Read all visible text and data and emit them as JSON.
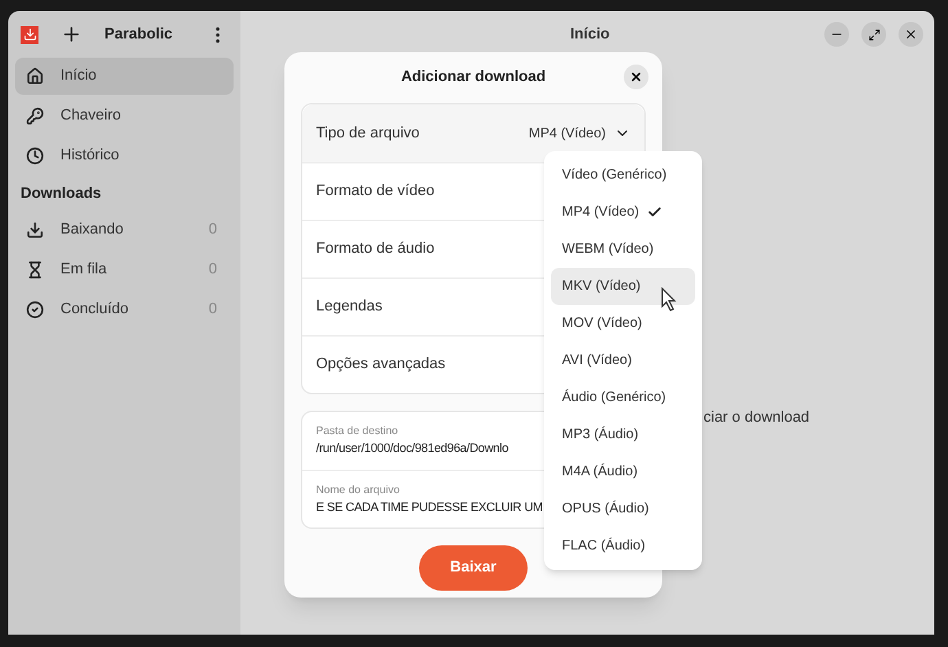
{
  "header": {
    "title": "Parabolic"
  },
  "sidebar": {
    "items": [
      {
        "label": "Início",
        "selected": true
      },
      {
        "label": "Chaveiro",
        "selected": false
      },
      {
        "label": "Histórico",
        "selected": false
      }
    ],
    "section": "Downloads",
    "downloads": [
      {
        "label": "Baixando",
        "count": "0",
        "selected": false
      },
      {
        "label": "Em fila",
        "count": "0",
        "selected": false
      },
      {
        "label": "Concluído",
        "count": "0",
        "selected": false
      }
    ]
  },
  "main": {
    "title": "Início",
    "hint": "ciar o download"
  },
  "dialog": {
    "title": "Adicionar download",
    "rows": [
      {
        "label": "Tipo de arquivo",
        "value": "MP4 (Vídeo)",
        "expanded": true
      },
      {
        "label": "Formato de vídeo"
      },
      {
        "label": "Formato de áudio"
      },
      {
        "label": "Legendas"
      },
      {
        "label": "Opções avançadas"
      }
    ],
    "fields": [
      {
        "label": "Pasta de destino",
        "value": "/run/user/1000/doc/981ed96a/Downlo"
      },
      {
        "label": "Nome do arquivo",
        "value": "E SE CADA TIME PUDESSE EXCLUIR UM"
      }
    ],
    "button": "Baixar"
  },
  "menu": [
    {
      "label": "Vídeo (Genérico)",
      "checked": false,
      "hovered": false
    },
    {
      "label": "MP4 (Vídeo)",
      "checked": true,
      "hovered": false
    },
    {
      "label": "WEBM (Vídeo)",
      "checked": false,
      "hovered": false
    },
    {
      "label": "MKV (Vídeo)",
      "checked": false,
      "hovered": true
    },
    {
      "label": "MOV (Vídeo)",
      "checked": false,
      "hovered": false
    },
    {
      "label": "AVI (Vídeo)",
      "checked": false,
      "hovered": false
    },
    {
      "label": "Áudio (Genérico)",
      "checked": false,
      "hovered": false
    },
    {
      "label": "MP3 (Áudio)",
      "checked": false,
      "hovered": false
    },
    {
      "label": "M4A (Áudio)",
      "checked": false,
      "hovered": false
    },
    {
      "label": "OPUS (Áudio)",
      "checked": false,
      "hovered": false
    },
    {
      "label": "FLAC (Áudio)",
      "checked": false,
      "hovered": false
    }
  ]
}
